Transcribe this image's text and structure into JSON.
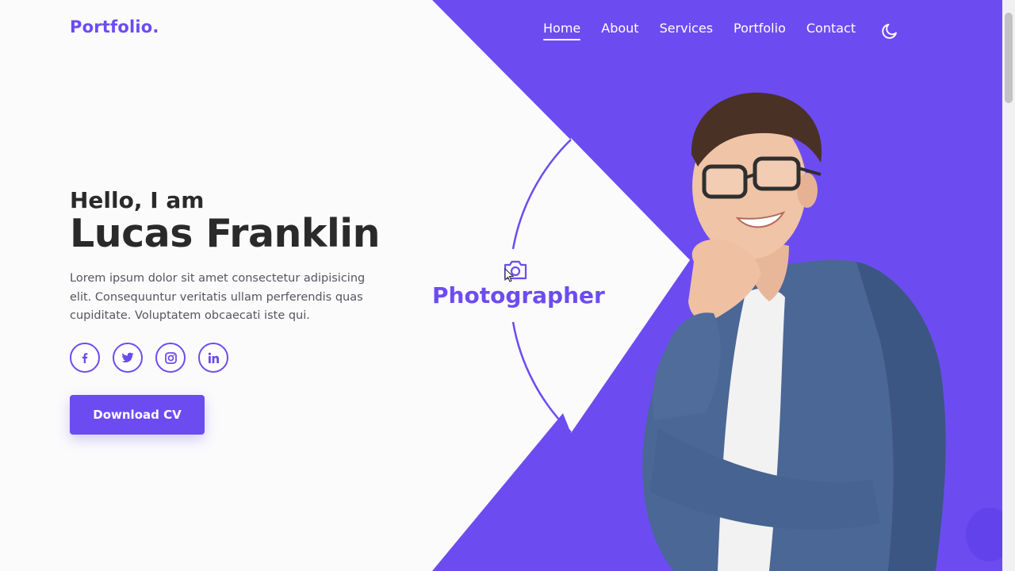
{
  "header": {
    "logo": "Portfolio.",
    "nav": [
      {
        "label": "Home",
        "active": true
      },
      {
        "label": "About",
        "active": false
      },
      {
        "label": "Services",
        "active": false
      },
      {
        "label": "Portfolio",
        "active": false
      },
      {
        "label": "Contact",
        "active": false
      }
    ],
    "theme_toggle_icon": "moon-icon"
  },
  "hero": {
    "greeting": "Hello, I am",
    "name": "Lucas Franklin",
    "description": "Lorem ipsum dolor sit amet consectetur adipisicing elit. Consequuntur veritatis ullam perferendis quas cupiditate. Voluptatem obcaecati iste qui.",
    "socials": [
      {
        "name": "facebook",
        "icon": "facebook-icon"
      },
      {
        "name": "twitter",
        "icon": "twitter-icon"
      },
      {
        "name": "instagram",
        "icon": "instagram-icon"
      },
      {
        "name": "linkedin",
        "icon": "linkedin-icon"
      }
    ],
    "cta_label": "Download CV",
    "role": "Photographer",
    "role_icon": "camera-icon"
  },
  "colors": {
    "accent": "#6c4cf1",
    "text_dark": "#2a2a2a",
    "background": "#fbfbfc"
  }
}
